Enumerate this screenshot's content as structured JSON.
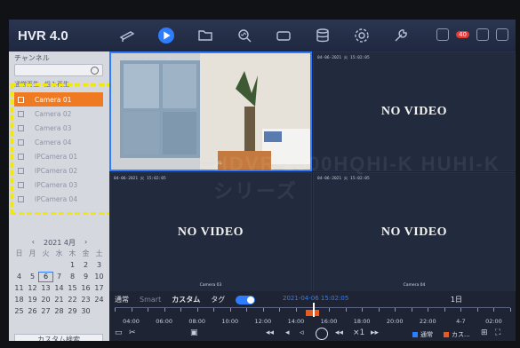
{
  "app": {
    "brand": "HVR 4.0"
  },
  "topnav": {
    "items": [
      {
        "name": "live-view-icon"
      },
      {
        "name": "playback-icon",
        "active": true
      },
      {
        "name": "file-manager-icon"
      },
      {
        "name": "search-icon"
      },
      {
        "name": "camera-icon"
      },
      {
        "name": "storage-icon"
      },
      {
        "name": "settings-icon"
      },
      {
        "name": "maintenance-icon"
      }
    ],
    "badge": "40"
  },
  "sidebar": {
    "header": "チャンネル",
    "tabs": [
      "通常再生",
      "組み再生"
    ],
    "channels": [
      {
        "label": "Camera 01",
        "selected": true
      },
      {
        "label": "Camera 02"
      },
      {
        "label": "Camera 03"
      },
      {
        "label": "Camera 04"
      },
      {
        "label": "IPCamera 01"
      },
      {
        "label": "IPCamera 02"
      },
      {
        "label": "IPCamera 03"
      },
      {
        "label": "IPCamera 04"
      }
    ]
  },
  "calendar": {
    "month": "2021 4月",
    "weekdays": [
      "日",
      "月",
      "火",
      "水",
      "木",
      "金",
      "土"
    ],
    "days": [
      "",
      "",
      "",
      "",
      "1",
      "2",
      "3",
      "4",
      "5",
      "6",
      "7",
      "8",
      "9",
      "10",
      "11",
      "12",
      "13",
      "14",
      "15",
      "16",
      "17",
      "18",
      "19",
      "20",
      "21",
      "22",
      "23",
      "24",
      "25",
      "26",
      "27",
      "28",
      "29",
      "30",
      ""
    ],
    "today": "6",
    "custom_search_label": "カスタム検索"
  },
  "video": {
    "tiles": [
      {
        "timestamp": "04-06-2021 火 15:02:05",
        "live": true,
        "camera_label": "Camera 01"
      },
      {
        "timestamp": "04-06-2021 火 15:02:05",
        "no_video_text": "NO VIDEO",
        "camera_label": ""
      },
      {
        "timestamp": "04-06-2021 火 15:02:05",
        "no_video_text": "NO VIDEO",
        "camera_label": "Camera 03"
      },
      {
        "timestamp": "04-06-2021 火 15:02:05",
        "no_video_text": "NO VIDEO",
        "camera_label": "Camera 04"
      }
    ],
    "watermark": "HDVR 2000HQHI-K HUHI-Kシリーズ"
  },
  "playback": {
    "mode_normal": "通常",
    "mode_smart": "Smart",
    "mode_custom": "カスタム",
    "mode_tag": "タグ",
    "current_time": "2021-04-06 15:02:05",
    "day_label": "1日",
    "time_labels": [
      "04:00",
      "06:00",
      "08:00",
      "10:00",
      "12:00",
      "14:00",
      "16:00",
      "18:00",
      "20:00",
      "22:00",
      "4-7",
      "02:00"
    ],
    "segment_start_hour": 14.6,
    "segment_end_hour": 15.4,
    "cursor_hour": 15.03,
    "legend_normal": "通常",
    "legend_event": "カス..."
  }
}
